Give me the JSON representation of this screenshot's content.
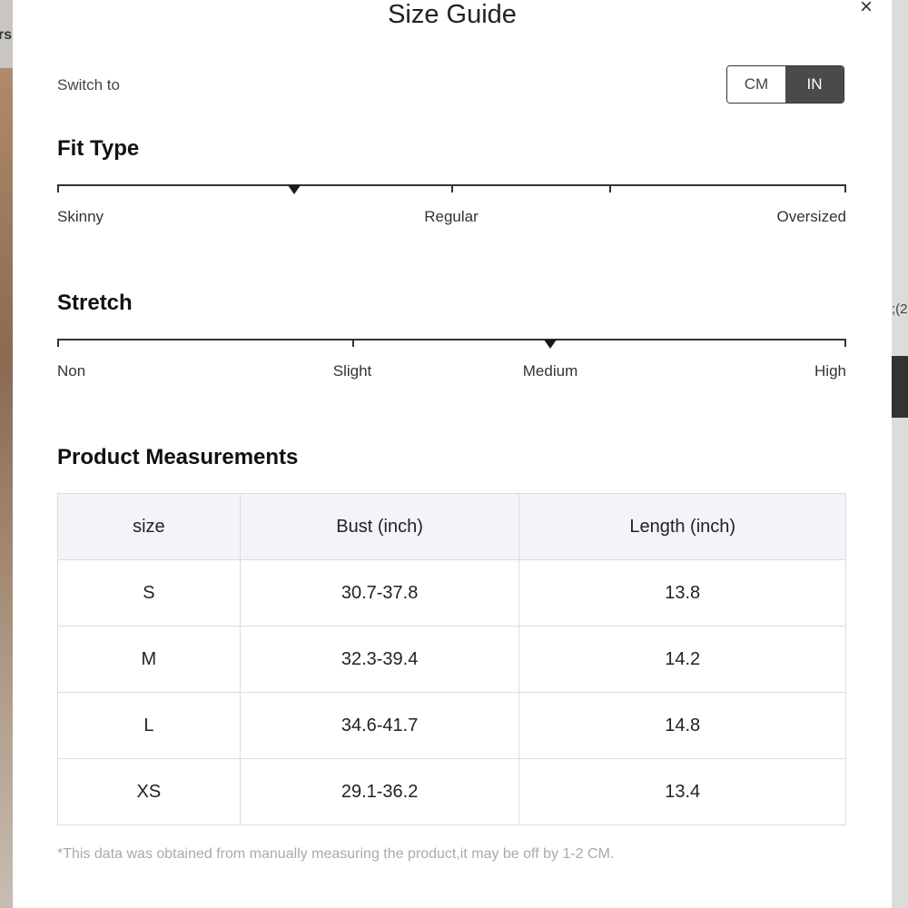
{
  "modal": {
    "title": "Size Guide",
    "close_glyph": "×",
    "switch_label": "Switch to",
    "units": {
      "cm": "CM",
      "in": "IN",
      "selected": "IN"
    }
  },
  "fit_type": {
    "title": "Fit Type",
    "labels": [
      "Skinny",
      "Regular",
      "Oversized"
    ],
    "selected_position": 0.3
  },
  "stretch": {
    "title": "Stretch",
    "labels": [
      "Non",
      "Slight",
      "Medium",
      "High"
    ],
    "selected_position": 0.625
  },
  "measurements": {
    "title": "Product Measurements",
    "columns": [
      "size",
      "Bust (inch)",
      "Length (inch)"
    ],
    "rows": [
      [
        "S",
        "30.7-37.8",
        "13.8"
      ],
      [
        "M",
        "32.3-39.4",
        "14.2"
      ],
      [
        "L",
        "34.6-41.7",
        "14.8"
      ],
      [
        "XS",
        "29.1-36.2",
        "13.4"
      ]
    ],
    "note": "*This data was obtained from manually measuring the product,it may be off by 1-2 CM."
  },
  "background": {
    "left_fragment": "rs",
    "right_fragment": ";(2"
  }
}
